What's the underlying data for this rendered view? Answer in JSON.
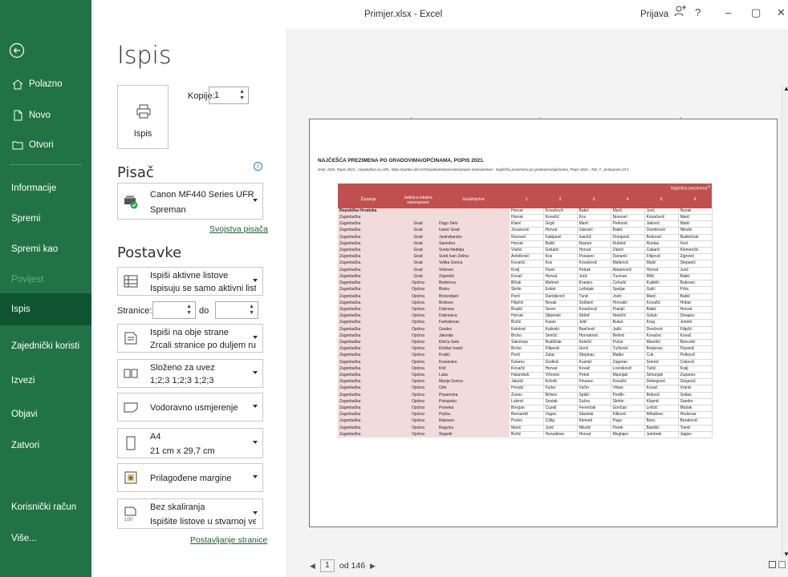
{
  "window": {
    "title": "Primjer.xlsx - Excel",
    "user": "Prijava",
    "help": "?",
    "min": "–",
    "restore": "▢",
    "close": "✕"
  },
  "sidebar": {
    "items": [
      {
        "label": "Polazno",
        "icon": "home-icon"
      },
      {
        "label": "Novo",
        "icon": "new-file-icon"
      },
      {
        "label": "Otvori",
        "icon": "folder-icon"
      },
      {
        "label": "Informacije"
      },
      {
        "label": "Spremi"
      },
      {
        "label": "Spremi kao"
      },
      {
        "label": "Povijest"
      },
      {
        "label": "Ispis"
      },
      {
        "label": "Zajednički koristi"
      },
      {
        "label": "Izvezi"
      },
      {
        "label": "Objavi"
      },
      {
        "label": "Zatvori"
      },
      {
        "label": "Korisnički račun"
      },
      {
        "label": "Više..."
      }
    ]
  },
  "print": {
    "heading": "Ispis",
    "button_label": "Ispis",
    "copies_label": "Kopije:",
    "copies_value": "1",
    "printer_heading": "Pisač",
    "printer_name": "Canon MF440 Series UFR II",
    "printer_status": "Spreman",
    "printer_props_link": "Svojstva pisača",
    "settings_heading": "Postavke",
    "opt_sheets_1": "Ispiši aktivne listove",
    "opt_sheets_2": "Ispisuju se samo aktivni list...",
    "pages_label": "Stranice:",
    "pages_to": "do",
    "opt_sides_1": "Ispiši na obje strane",
    "opt_sides_2": "Zrcali stranice po duljem ru...",
    "opt_collate_1": "Složeno za uvez",
    "opt_collate_2": "1;2;3   1;2;3   1;2;3",
    "opt_orient_1": "Vodoravno usmjerenje",
    "opt_paper_1": "A4",
    "opt_paper_2": "21 cm x 29,7 cm",
    "opt_margins_1": "Prilagođene margine",
    "opt_scale_1": "Bez skaliranja",
    "opt_scale_2": "Ispišite listove u stvarnoj veli...",
    "page_setup_link": "Postavljanje stranice"
  },
  "pager": {
    "current": "1",
    "of": "od 146"
  },
  "doc": {
    "title": "NAJČEŠĆA PREZIMENA PO GRADOVIMA/OPĆINAMA, POPIS 2021.",
    "source": "Izvor: DZS, Popis 2021., raspoloživo na URL: https://podaci.dzs.hr/hr/podaci/stanovnistvo/popis-stanovnistva/ - Najčešća prezimena po gradovima/općinama, Popis 2021., Tab. 7., pristupano 23.1",
    "headers": {
      "zupanija": "Županija",
      "jedinica": "Jedinica lokalne samouprave",
      "grad": "Grad/općina",
      "group": "Najčešća prezimena",
      "sup": "1)",
      "nums": [
        "1",
        "2",
        "3",
        "4",
        "5",
        "6"
      ]
    },
    "rows": [
      [
        "Republika Hrvatska",
        "",
        "",
        "Horvat",
        "Kovačević",
        "Babić",
        "Marić",
        "Jurić",
        "Novak"
      ],
      [
        "Zagrebačka",
        "",
        "",
        "Horvat",
        "Kovačić",
        "Kos",
        "Novosel",
        "Kovačević",
        "Marić"
      ],
      [
        "Zagrebačka",
        "Grad",
        "Dugo Selo",
        "Klarić",
        "Grgić",
        "Marić",
        "Perković",
        "Jaković",
        "Matić"
      ],
      [
        "Zagrebačka",
        "Grad",
        "Ivanić Grad",
        "Jovanović",
        "Horvat",
        "Vuković",
        "Babić",
        "Domitrović",
        "Nikolić"
      ],
      [
        "Zagrebačka",
        "Grad",
        "Jastrebarsko",
        "Novosel",
        "Fabijanić",
        "Ivančić",
        "Domjanić",
        "Borković",
        "Budinšćak"
      ],
      [
        "Zagrebačka",
        "Grad",
        "Samobor",
        "Horvat",
        "Bašić",
        "Razum",
        "Rubinić",
        "Runtas",
        "Fesl"
      ],
      [
        "Zagrebačka",
        "Grad",
        "Sveta Nedelja",
        "Vlašić",
        "Golubić",
        "Horvat",
        "Žitarić",
        "Čakarić",
        "Klemenčić"
      ],
      [
        "Zagrebačka",
        "Grad",
        "Sveti Ivan Zelina",
        "Antolković",
        "Kos",
        "Posavec",
        "Dananić",
        "Filipović",
        "Žigrović"
      ],
      [
        "Zagrebačka",
        "Grad",
        "Velika Gorica",
        "Kovačić",
        "Kos",
        "Kovačević",
        "Matković",
        "Matić",
        "Stepanić"
      ],
      [
        "Zagrebačka",
        "Grad",
        "Vrbovec",
        "Kralj",
        "Pavić",
        "Petrak",
        "Abramović",
        "Horvat",
        "Jurić"
      ],
      [
        "Zagrebačka",
        "Grad",
        "Zaprešić",
        "Kovač",
        "Horvat",
        "Jurić",
        "Tucman",
        "Milić",
        "Babić"
      ],
      [
        "Zagrebačka",
        "Općina",
        "Bedenica",
        "Bičak",
        "Mahnet",
        "Kranjec",
        "Čehulić",
        "Kudelić",
        "Bukovec"
      ],
      [
        "Zagrebačka",
        "Općina",
        "Bistra",
        "Škrlin",
        "Erdek",
        "Lešinjak",
        "Špoljar",
        "Gulić",
        "Pršа"
      ],
      [
        "Zagrebačka",
        "Općina",
        "Brckovljani",
        "Perić",
        "Daroijković",
        "Tunić",
        "Jozić",
        "Marić",
        "Babić"
      ],
      [
        "Zagrebačka",
        "Općina",
        "Brdovec",
        "Filipčić",
        "Novak",
        "Šoštarić",
        "Horvatić",
        "Kovačić",
        "Hribar"
      ],
      [
        "Zagrebačka",
        "Općina",
        "Dubrava",
        "Bradić",
        "Sever",
        "Kovačević",
        "Pranjić",
        "Babić",
        "Horvat"
      ],
      [
        "Zagrebačka",
        "Općina",
        "Dubravica",
        "Horvat",
        "Stiperski",
        "Štritof",
        "Nemčić",
        "Golub",
        "Smapuc"
      ],
      [
        "Zagrebačka",
        "Općina",
        "Farkaševac",
        "Božić",
        "Karan",
        "Jelić",
        "Bukal",
        "Krog",
        "Jembri"
      ],
      [
        "Zagrebačka",
        "Općina",
        "Gradec",
        "Kelekvić",
        "Kalinski",
        "Bančević",
        "Jažić",
        "Dončević",
        "Filipčić"
      ],
      [
        "Zagrebačka",
        "Općina",
        "Jakovlje",
        "Brcko",
        "Senčić",
        "Horvatović",
        "Belinić",
        "Kovačec",
        "Kovač"
      ],
      [
        "Zagrebačka",
        "Općina",
        "Klinča Sela",
        "Sakoman",
        "Budiščak",
        "Kelečić",
        "Pučar",
        "Marešić",
        "Bencetić"
      ],
      [
        "Zagrebačka",
        "Općina",
        "Kloštar Ivanić",
        "Brcko",
        "Filipović",
        "Gorić",
        "Tučković",
        "Bunjevac",
        "Pavanić"
      ],
      [
        "Zagrebačka",
        "Općina",
        "Krašić",
        "Perić",
        "Žalac",
        "Stepinac",
        "Matko",
        "Čuk",
        "Petković"
      ],
      [
        "Zagrebačka",
        "Općina",
        "Kravarsko",
        "Kolarec",
        "Godinić",
        "Kuzmić",
        "Zagorac",
        "Sremić",
        "Ceković"
      ],
      [
        "Zagrebačka",
        "Općina",
        "Križ",
        "Kovačić",
        "Horvat",
        "Kovač",
        "Lovreković",
        "Tušić",
        "Kralj"
      ],
      [
        "Zagrebačka",
        "Općina",
        "Luka",
        "Halambek",
        "Vrhovec",
        "Petek",
        "Masnjak",
        "Šimunjak",
        "Županec"
      ],
      [
        "Zagrebačka",
        "Općina",
        "Marija Gorica",
        "Jakolić",
        "Krčelić",
        "Frkanec",
        "Kovačić",
        "Debogović",
        "Glogović"
      ],
      [
        "Zagrebačka",
        "Općina",
        "Orle",
        "Hrvojić",
        "Furko",
        "Vučin",
        "Vrban",
        "Kovač",
        "Vranić"
      ],
      [
        "Zagrebačka",
        "Općina",
        "Pisarovina",
        "Žunec",
        "Brlivec",
        "Špišić",
        "Perđin",
        "Brdović",
        "Soltan"
      ],
      [
        "Zagrebačka",
        "Općina",
        "Pokupsko",
        "Lukinić",
        "Šestak",
        "Sučec",
        "Skrbin",
        "Klasnić",
        "Šandor"
      ],
      [
        "Zagrebačka",
        "Općina",
        "Preseka",
        "Brezjan",
        "Cuzelj",
        "Ferenčak",
        "Goričan",
        "Lešćić",
        "Mušak"
      ],
      [
        "Zagrebačka",
        "Općina",
        "Pušća",
        "Bernardić",
        "Vugec",
        "Slanšak",
        "Filković",
        "Mihalinec",
        "Hruševar"
      ],
      [
        "Zagrebačka",
        "Općina",
        "Rakovec",
        "Prelec",
        "Čdlig",
        "Klemeš",
        "Pajur",
        "Benc",
        "Beraković"
      ],
      [
        "Zagrebačka",
        "Općina",
        "Rugvica",
        "Marić",
        "Jurić",
        "Nikolić",
        "Perek",
        "Banišić",
        "Tomić"
      ],
      [
        "Zagrebačka",
        "Općina",
        "Stupnik",
        "Božić",
        "Horvatinec",
        "Horvat",
        "Meglajec",
        "Jambrek",
        "Japjec"
      ]
    ]
  }
}
